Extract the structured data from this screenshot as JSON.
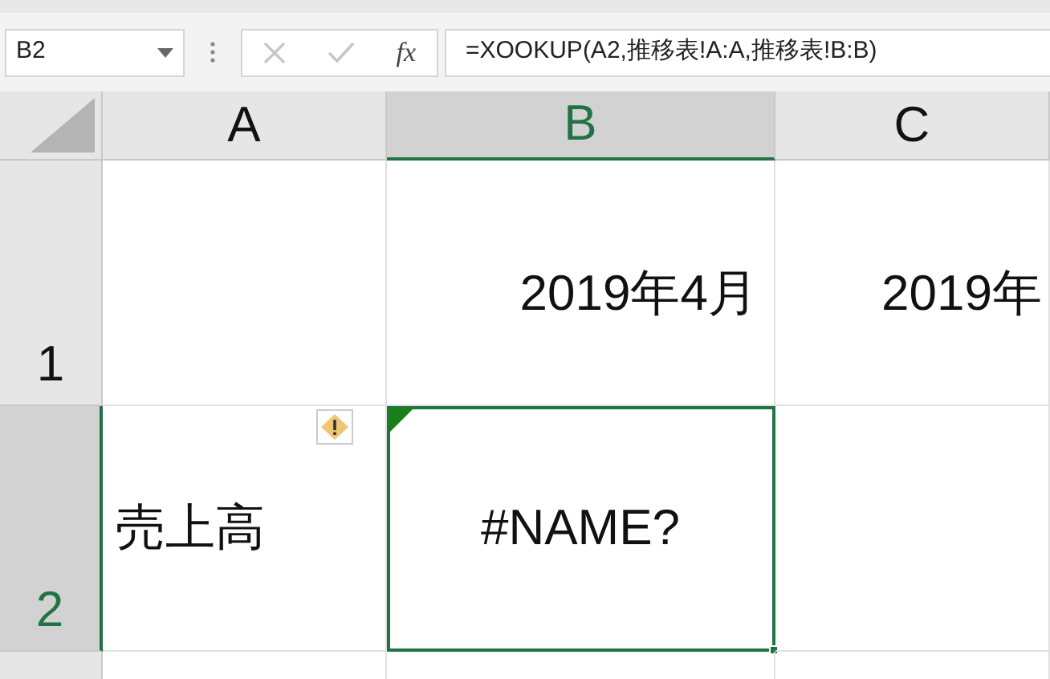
{
  "name_box": {
    "value": "B2"
  },
  "formula_bar": {
    "fx": "fx",
    "value": "=XOOKUP(A2,推移表!A:A,推移表!B:B)",
    "cancel_disabled": true,
    "enter_disabled": true
  },
  "columns": [
    {
      "label": "A",
      "selected": false
    },
    {
      "label": "B",
      "selected": true
    },
    {
      "label": "C",
      "selected": false
    }
  ],
  "rows": [
    {
      "label": "1",
      "selected": false,
      "cells": [
        {},
        {
          "text": "2019年4月"
        },
        {
          "text": "2019年"
        }
      ]
    },
    {
      "label": "2",
      "selected": true,
      "cells": [
        {
          "text": "売上高",
          "warning": true
        },
        {
          "text": "#NAME?",
          "selected": true,
          "error": true
        },
        {}
      ]
    }
  ]
}
